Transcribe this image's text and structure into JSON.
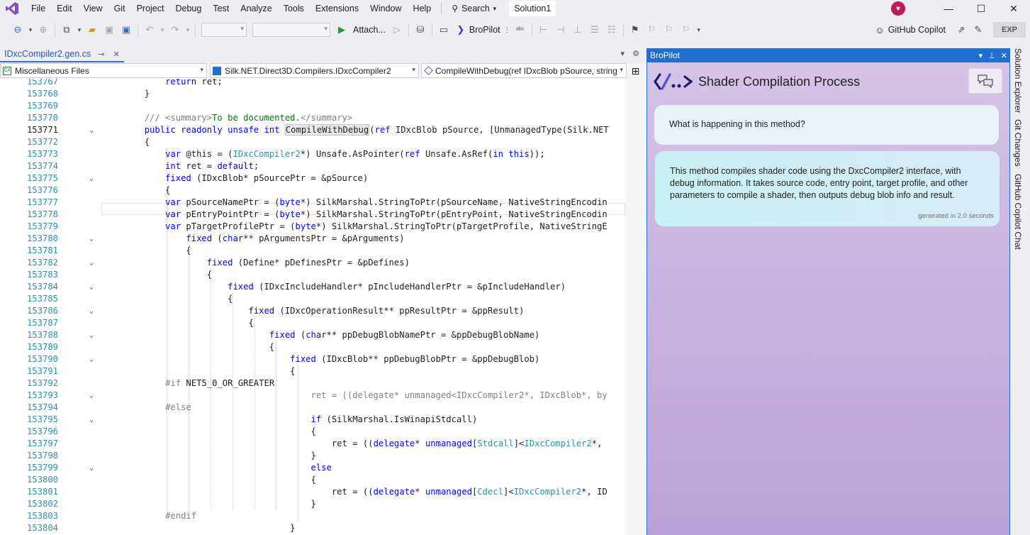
{
  "menu": {
    "items": [
      "File",
      "Edit",
      "View",
      "Git",
      "Project",
      "Debug",
      "Test",
      "Analyze",
      "Tools",
      "Extensions",
      "Window",
      "Help"
    ],
    "search_label": "Search",
    "solution_title": "Solution1"
  },
  "toolbar": {
    "attach_label": "Attach...",
    "bropilot_label": "BroPilot",
    "copilot_label": "GitHub Copilot",
    "exp_label": "EXP"
  },
  "document": {
    "tab_name": "IDxcCompiler2.gen.cs",
    "nav_project": "Miscellaneous Files",
    "nav_class": "Silk.NET.Direct3D.Compilers.IDxcCompiler2",
    "nav_member": "CompileWithDebug(ref IDxcBlob pSource, string"
  },
  "editor": {
    "lines": [
      {
        "n": "153767",
        "fold": "",
        "code": [
          [
            "",
            "            "
          ],
          [
            "kw",
            "return"
          ],
          [
            "",
            " ret;"
          ]
        ]
      },
      {
        "n": "153768",
        "fold": "",
        "code": [
          [
            "",
            "        }"
          ]
        ]
      },
      {
        "n": "153769",
        "fold": "",
        "code": [
          [
            "",
            ""
          ]
        ]
      },
      {
        "n": "153770",
        "fold": "",
        "code": [
          [
            "",
            "        "
          ],
          [
            "gy",
            "/// <summary>"
          ],
          [
            "cm",
            "To be documented."
          ],
          [
            "gy",
            "</summary>"
          ]
        ]
      },
      {
        "n": "153771",
        "fold": "v",
        "cur": true,
        "code": [
          [
            "",
            "        "
          ],
          [
            "kw",
            "public readonly unsafe int "
          ],
          [
            "hl",
            "CompileWithDebug"
          ],
          [
            "",
            "("
          ],
          [
            "kw",
            "ref"
          ],
          [
            "",
            " IDxcBlob pSource, [UnmanagedType(Silk.NET"
          ]
        ]
      },
      {
        "n": "153772",
        "fold": "",
        "code": [
          [
            "",
            "        {"
          ]
        ]
      },
      {
        "n": "153773",
        "fold": "",
        "code": [
          [
            "",
            "            "
          ],
          [
            "kw",
            "var"
          ],
          [
            "",
            " @this = ("
          ],
          [
            "ty",
            "IDxcCompiler2"
          ],
          [
            "",
            "*) Unsafe.AsPointer("
          ],
          [
            "kw",
            "ref"
          ],
          [
            "",
            " Unsafe.AsRef("
          ],
          [
            "kw",
            "in this"
          ],
          [
            "",
            "));"
          ]
        ]
      },
      {
        "n": "153774",
        "fold": "",
        "code": [
          [
            "",
            "            "
          ],
          [
            "kw",
            "int"
          ],
          [
            "",
            " ret = "
          ],
          [
            "kw",
            "default"
          ],
          [
            "",
            ";"
          ]
        ]
      },
      {
        "n": "153775",
        "fold": "v",
        "code": [
          [
            "",
            "            "
          ],
          [
            "kw",
            "fixed"
          ],
          [
            "",
            " (IDxcBlob* pSourcePtr = &pSource)"
          ]
        ]
      },
      {
        "n": "153776",
        "fold": "",
        "code": [
          [
            "",
            "            {"
          ]
        ]
      },
      {
        "n": "153777",
        "fold": "",
        "code": [
          [
            "",
            "            "
          ],
          [
            "kw",
            "var"
          ],
          [
            "",
            " pSourceNamePtr = ("
          ],
          [
            "kw",
            "byte"
          ],
          [
            "",
            "*) SilkMarshal.StringToPtr(pSourceName, NativeStringEncodin"
          ]
        ]
      },
      {
        "n": "153778",
        "fold": "",
        "code": [
          [
            "",
            "            "
          ],
          [
            "kw",
            "var"
          ],
          [
            "",
            " pEntryPointPtr = ("
          ],
          [
            "kw",
            "byte"
          ],
          [
            "",
            "*) SilkMarshal.StringToPtr(pEntryPoint, NativeStringEncodin"
          ]
        ]
      },
      {
        "n": "153779",
        "fold": "",
        "code": [
          [
            "",
            "            "
          ],
          [
            "kw",
            "var"
          ],
          [
            "",
            " pTargetProfilePtr = ("
          ],
          [
            "kw",
            "byte"
          ],
          [
            "",
            "*) SilkMarshal.StringToPtr(pTargetProfile, NativeStringE"
          ]
        ]
      },
      {
        "n": "153780",
        "fold": "v",
        "code": [
          [
            "",
            "                "
          ],
          [
            "kw",
            "fixed"
          ],
          [
            "",
            " ("
          ],
          [
            "kw",
            "char"
          ],
          [
            "",
            "** pArgumentsPtr = &pArguments)"
          ]
        ]
      },
      {
        "n": "153781",
        "fold": "",
        "code": [
          [
            "",
            "                {"
          ]
        ]
      },
      {
        "n": "153782",
        "fold": "v",
        "code": [
          [
            "",
            "                    "
          ],
          [
            "kw",
            "fixed"
          ],
          [
            "",
            " (Define* pDefinesPtr = &pDefines)"
          ]
        ]
      },
      {
        "n": "153783",
        "fold": "",
        "code": [
          [
            "",
            "                    {"
          ]
        ]
      },
      {
        "n": "153784",
        "fold": "v",
        "code": [
          [
            "",
            "                        "
          ],
          [
            "kw",
            "fixed"
          ],
          [
            "",
            " (IDxcIncludeHandler* pIncludeHandlerPtr = &pIncludeHandler)"
          ]
        ]
      },
      {
        "n": "153785",
        "fold": "",
        "code": [
          [
            "",
            "                        {"
          ]
        ]
      },
      {
        "n": "153786",
        "fold": "v",
        "code": [
          [
            "",
            "                            "
          ],
          [
            "kw",
            "fixed"
          ],
          [
            "",
            " (IDxcOperationResult** ppResultPtr = &ppResult)"
          ]
        ]
      },
      {
        "n": "153787",
        "fold": "",
        "code": [
          [
            "",
            "                            {"
          ]
        ]
      },
      {
        "n": "153788",
        "fold": "v",
        "code": [
          [
            "",
            "                                "
          ],
          [
            "kw",
            "fixed"
          ],
          [
            "",
            " ("
          ],
          [
            "kw",
            "char"
          ],
          [
            "",
            "** ppDebugBlobNamePtr = &ppDebugBlobName)"
          ]
        ]
      },
      {
        "n": "153789",
        "fold": "",
        "code": [
          [
            "",
            "                                {"
          ]
        ]
      },
      {
        "n": "153790",
        "fold": "v",
        "code": [
          [
            "",
            "                                    "
          ],
          [
            "kw",
            "fixed"
          ],
          [
            "",
            " (IDxcBlob** ppDebugBlobPtr = &ppDebugBlob)"
          ]
        ]
      },
      {
        "n": "153791",
        "fold": "",
        "code": [
          [
            "",
            "                                    {"
          ]
        ]
      },
      {
        "n": "153792",
        "fold": "",
        "code": [
          [
            "",
            "            "
          ],
          [
            "pp",
            "#if"
          ],
          [
            "",
            " NET5_0_OR_GREATER"
          ]
        ]
      },
      {
        "n": "153793",
        "fold": "v",
        "code": [
          [
            "",
            "                                        "
          ],
          [
            "dis",
            "ret = ((delegate* unmanaged<IDxcCompiler2*, IDxcBlob*, by"
          ]
        ]
      },
      {
        "n": "153794",
        "fold": "",
        "code": [
          [
            "",
            "            "
          ],
          [
            "pp",
            "#else"
          ]
        ]
      },
      {
        "n": "153795",
        "fold": "v",
        "code": [
          [
            "",
            "                                        "
          ],
          [
            "kw",
            "if"
          ],
          [
            "",
            " (SilkMarshal.IsWinapiStdcall)"
          ]
        ]
      },
      {
        "n": "153796",
        "fold": "",
        "code": [
          [
            "",
            "                                        {"
          ]
        ]
      },
      {
        "n": "153797",
        "fold": "",
        "code": [
          [
            "",
            "                                            ret = (("
          ],
          [
            "kw",
            "delegate"
          ],
          [
            "",
            "* "
          ],
          [
            "kw",
            "unmanaged"
          ],
          [
            "",
            "["
          ],
          [
            "ty",
            "Stdcall"
          ],
          [
            "",
            "]<"
          ],
          [
            "ty",
            "IDxcCompiler2"
          ],
          [
            "",
            "*,"
          ]
        ]
      },
      {
        "n": "153798",
        "fold": "",
        "code": [
          [
            "",
            "                                        }"
          ]
        ]
      },
      {
        "n": "153799",
        "fold": "v",
        "code": [
          [
            "",
            "                                        "
          ],
          [
            "kw",
            "else"
          ]
        ]
      },
      {
        "n": "153800",
        "fold": "",
        "code": [
          [
            "",
            "                                        {"
          ]
        ]
      },
      {
        "n": "153801",
        "fold": "",
        "code": [
          [
            "",
            "                                            ret = (("
          ],
          [
            "kw",
            "delegate"
          ],
          [
            "",
            "* "
          ],
          [
            "kw",
            "unmanaged"
          ],
          [
            "",
            "["
          ],
          [
            "ty",
            "Cdecl"
          ],
          [
            "",
            "]<"
          ],
          [
            "ty",
            "IDxcCompiler2"
          ],
          [
            "",
            "*, ID"
          ]
        ]
      },
      {
        "n": "153802",
        "fold": "",
        "code": [
          [
            "",
            "                                        }"
          ]
        ]
      },
      {
        "n": "153803",
        "fold": "",
        "code": [
          [
            "",
            "            "
          ],
          [
            "pp",
            "#endif"
          ]
        ]
      },
      {
        "n": "153804",
        "fold": "",
        "code": [
          [
            "",
            "                                    }"
          ]
        ]
      }
    ]
  },
  "bropilot": {
    "header_title": "BroPilot",
    "panel_title": "Shader Compilation Process",
    "user_message": "What is happening in this method?",
    "bot_message": "This method compiles shader code using the DxcCompiler2 interface, with debug information. It takes source code, entry point, target profile, and other parameters to compile a shader, then outputs debug blob info and result.",
    "bot_meta": "generated in 2.0 seconds"
  },
  "side_tabs": [
    "Solution Explorer",
    "Git Changes",
    "GitHub Copilot Chat"
  ],
  "colors": {
    "accent": "#1e6fcf",
    "keyword": "#0000ff",
    "type": "#2b91af",
    "comment": "#008000"
  }
}
